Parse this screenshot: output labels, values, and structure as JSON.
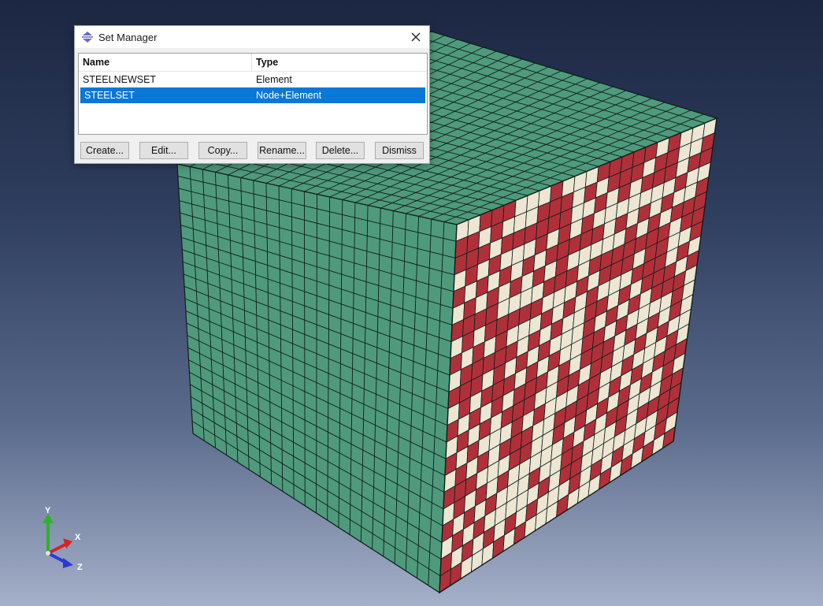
{
  "dialog": {
    "title": "Set Manager",
    "columns": {
      "name": "Name",
      "type": "Type"
    },
    "rows": [
      {
        "name": "STEELNEWSET",
        "type": "Element",
        "selected": false
      },
      {
        "name": "STEELSET",
        "type": "Node+Element",
        "selected": true
      }
    ],
    "buttons": {
      "create": "Create...",
      "edit": "Edit...",
      "copy": "Copy...",
      "rename": "Rename...",
      "delete": "Delete...",
      "dismiss": "Dismiss"
    },
    "selection_color": "#0a78d7"
  },
  "viewport": {
    "colors": {
      "mesh_green": "#4f9a7c",
      "mesh_lines": "#0d1f1a",
      "steel_red": "#b0303a",
      "cream": "#ece6d2",
      "background_top": "#1c2742",
      "background_bottom": "#a5b0c9"
    }
  },
  "triad": {
    "x": "X",
    "y": "Y",
    "z": "Z",
    "x_color": "#d42424",
    "y_color": "#29b429",
    "z_color": "#2b3ad6"
  },
  "icons": {
    "app": "set-manager-icon",
    "close": "close-icon"
  }
}
